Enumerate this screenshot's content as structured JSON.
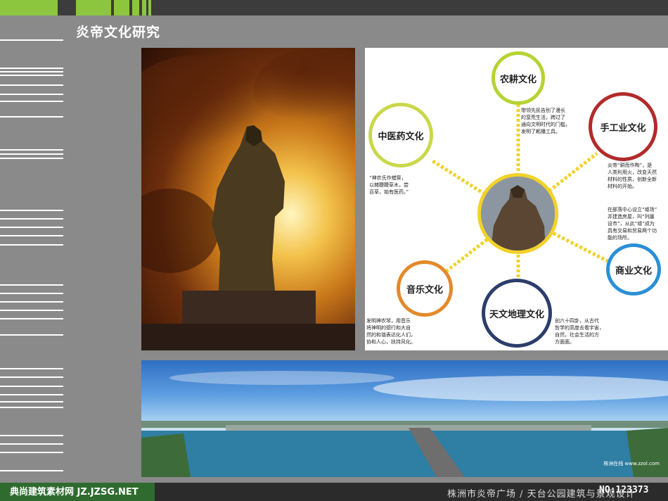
{
  "header": {
    "title": "炎帝文化研究",
    "accent_color": "#8cc63f",
    "bar_color": "#3c3c3c"
  },
  "diagram": {
    "center_image": "炎帝雕像",
    "nodes": {
      "farming": {
        "label": "农耕文化",
        "color": "#b5d334"
      },
      "handicraft": {
        "label": "手工业文化",
        "color": "#b22a2a"
      },
      "medicine": {
        "label": "中医药文化",
        "color": "#c9d84a"
      },
      "commerce": {
        "label": "商业文化",
        "color": "#2a8fd6"
      },
      "music": {
        "label": "音乐文化",
        "color": "#e3892a"
      },
      "astronomy": {
        "label": "天文地理文化",
        "color": "#2c3d6b"
      }
    },
    "descriptions": {
      "farming": [
        "带领先民告别了漫长",
        "的蛮荒生活，跨过了",
        "通向文明时代的门槛，",
        "发明了耜播工具。"
      ],
      "handicraft": [
        "炎帝“耕而作陶”，是",
        "人类利用火，改变天然",
        "材料的性质，创新全新",
        "材料的开始。"
      ],
      "medicine": [
        "“神农氏作蜡祭，",
        "以赭鞭鞭草木，尝",
        "百草，始有医药。”"
      ],
      "commerce": [
        "在部落中心设立“墟场”",
        "并建造房屋，叫“列廛",
        "设市”，从此“墟”成为",
        "具有交易和贸易两个功",
        "能的场所。"
      ],
      "music": [
        "发明神农琴，用音乐",
        "将神明的德行和大自",
        "然的和谐表达化人们，",
        "协和人心，扶持风化。"
      ],
      "astronomy": [
        "创六十四卦，从古代",
        "哲学的高度去看宇宙，",
        "自然，社会生活的方",
        "方面面。"
      ]
    },
    "connector_color": "#f2d22a"
  },
  "panorama": {
    "caption": "株洲在线 www.zzol.com"
  },
  "footer": {
    "left_watermark": "典尚建筑素材网 JZ.JZSG.NET",
    "title": "株洲市炎帝广场 / 天台公园建筑与景观设计",
    "code": "NO:123373"
  }
}
